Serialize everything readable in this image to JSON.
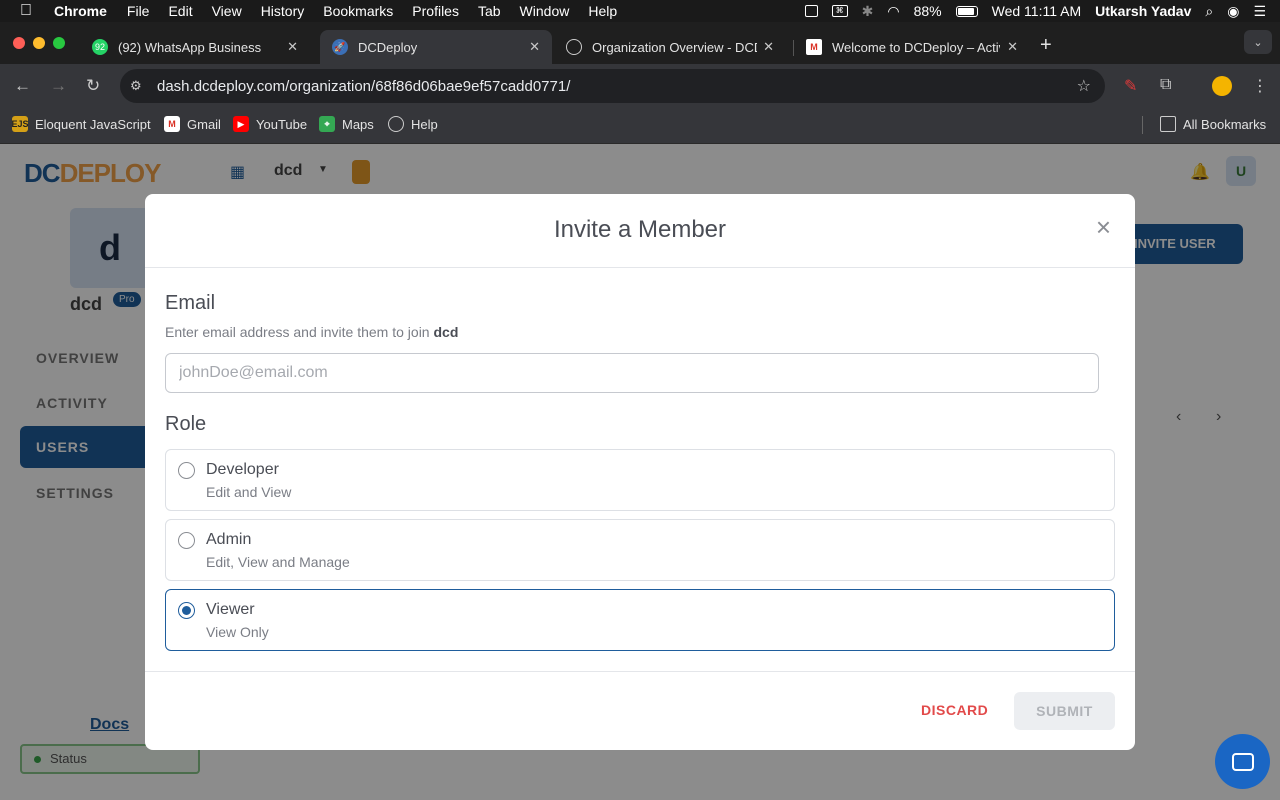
{
  "menubar": {
    "app": "Chrome",
    "items": [
      "File",
      "Edit",
      "View",
      "History",
      "Bookmarks",
      "Profiles",
      "Tab",
      "Window",
      "Help"
    ],
    "battery": "88%",
    "datetime": "Wed 11:11 AM",
    "user": "Utkarsh Yadav"
  },
  "tabs": [
    {
      "title": "(92) WhatsApp Business",
      "badge": "92"
    },
    {
      "title": "DCDeploy"
    },
    {
      "title": "Organization Overview - DCD"
    },
    {
      "title": "Welcome to DCDeploy – Activ"
    }
  ],
  "address_bar": {
    "url": "dash.dcdeploy.com/organization/68f86d06bae9ef57cadd0771/"
  },
  "bookmarks": [
    {
      "label": "Eloquent JavaScript",
      "icon": "EJS"
    },
    {
      "label": "Gmail",
      "icon": "gmail-icon"
    },
    {
      "label": "YouTube",
      "icon": "youtube-icon"
    },
    {
      "label": "Maps",
      "icon": "maps-icon"
    },
    {
      "label": "Help",
      "icon": "globe-icon"
    }
  ],
  "all_bookmarks": "All Bookmarks",
  "background_page": {
    "logo_a": "DC",
    "logo_b": "DEPLOY",
    "org_switcher": "dcd",
    "org_initial": "d",
    "org_name": "dcd",
    "plan_badge": "Pro",
    "nav": [
      "OVERVIEW",
      "ACTIVITY",
      "USERS",
      "SETTINGS"
    ],
    "invite_button": "INVITE USER",
    "docs_link": "Docs",
    "status": "Status",
    "avatar_initial": "U"
  },
  "modal": {
    "title": "Invite a Member",
    "email_label": "Email",
    "email_help_prefix": "Enter email address and invite them to join",
    "email_help_org": "dcd",
    "email_placeholder": "johnDoe@email.com",
    "email_value": "",
    "role_label": "Role",
    "roles": [
      {
        "name": "Developer",
        "desc": "Edit and View",
        "selected": false
      },
      {
        "name": "Admin",
        "desc": "Edit, View and Manage",
        "selected": false
      },
      {
        "name": "Viewer",
        "desc": "View Only",
        "selected": true
      }
    ],
    "discard_label": "DISCARD",
    "submit_label": "SUBMIT"
  },
  "colors": {
    "primary": "#1f5d9c",
    "danger": "#e24a4a",
    "disabled": "#eceef1"
  }
}
